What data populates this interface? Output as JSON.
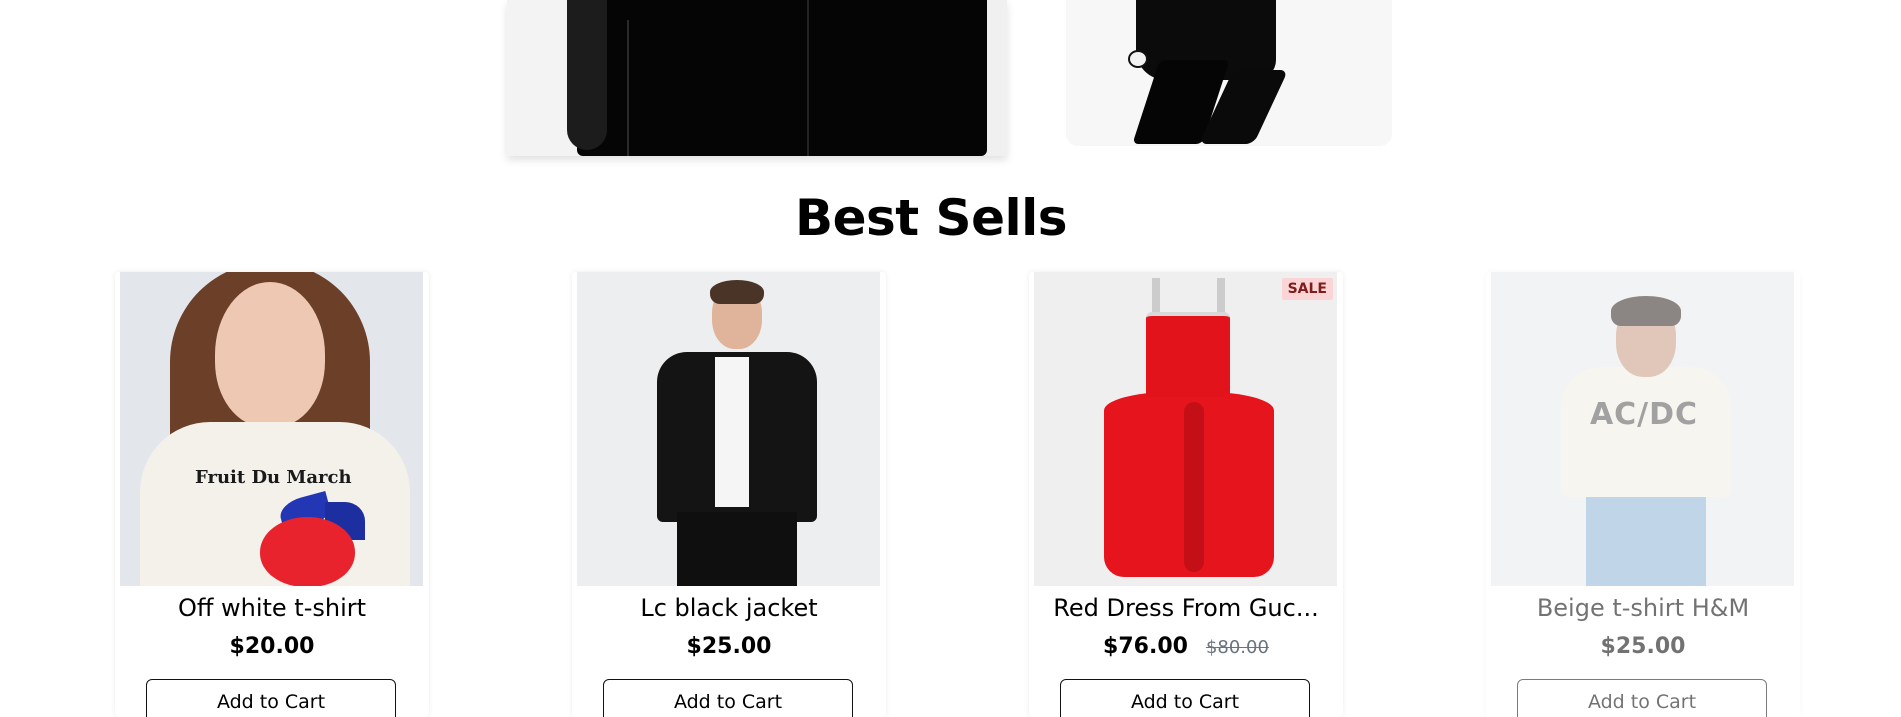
{
  "section": {
    "title": "Best Sells"
  },
  "products": [
    {
      "name": "Off white t-shirt",
      "price": "$20.00",
      "button": "Add to Cart",
      "image_text": "Fruit Du March"
    },
    {
      "name": "Lc black jacket",
      "price": "$25.00",
      "button": "Add to Cart"
    },
    {
      "name": "Red Dress From Guc...",
      "price": "$76.00",
      "old_price": "$80.00",
      "badge": "SALE",
      "button": "Add to Cart"
    },
    {
      "name": "Beige t-shirt H&M",
      "price": "$25.00",
      "button": "Add to Cart",
      "image_text": "AC/DC"
    }
  ],
  "colors": {
    "sale_badge_bg": "#fbd5d5",
    "sale_badge_text": "#7f1d1d",
    "old_price": "#6b7280"
  }
}
